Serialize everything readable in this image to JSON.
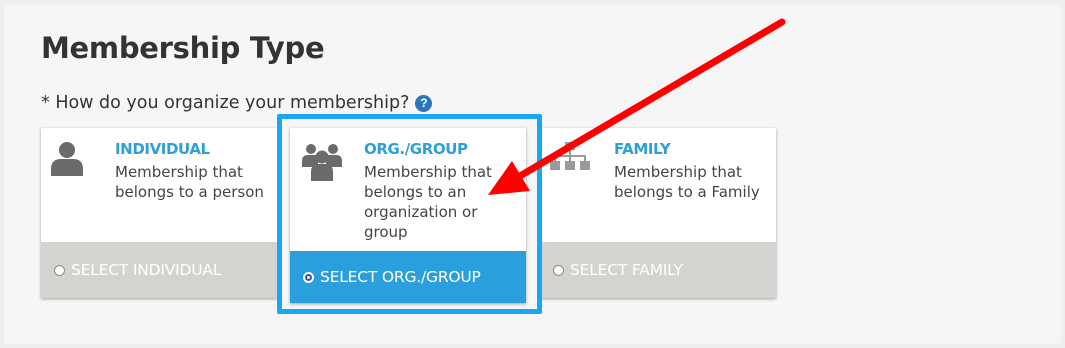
{
  "page": {
    "title": "Membership Type",
    "question": "* How do you organize your membership?",
    "help_icon": "?"
  },
  "options": [
    {
      "title": "INDIVIDUAL",
      "description": "Membership that belongs to a person",
      "select_label": "SELECT INDIVIDUAL",
      "icon": "person-icon",
      "selected": false
    },
    {
      "title": "ORG./GROUP",
      "description": "Membership that belongs to an organization or group",
      "select_label": "SELECT ORG./GROUP",
      "icon": "group-icon",
      "selected": true
    },
    {
      "title": "FAMILY",
      "description": "Membership that belongs to a Family",
      "select_label": "SELECT FAMILY",
      "icon": "family-tree-icon",
      "selected": false
    }
  ],
  "colors": {
    "accent": "#2e9fd8",
    "selected_footer": "#2a9fdb",
    "unselected_footer": "#d3d3d0",
    "highlight_border": "#1aa6f0",
    "annotation_arrow": "#ff0000",
    "icon_gray": "#6b6b6b"
  }
}
